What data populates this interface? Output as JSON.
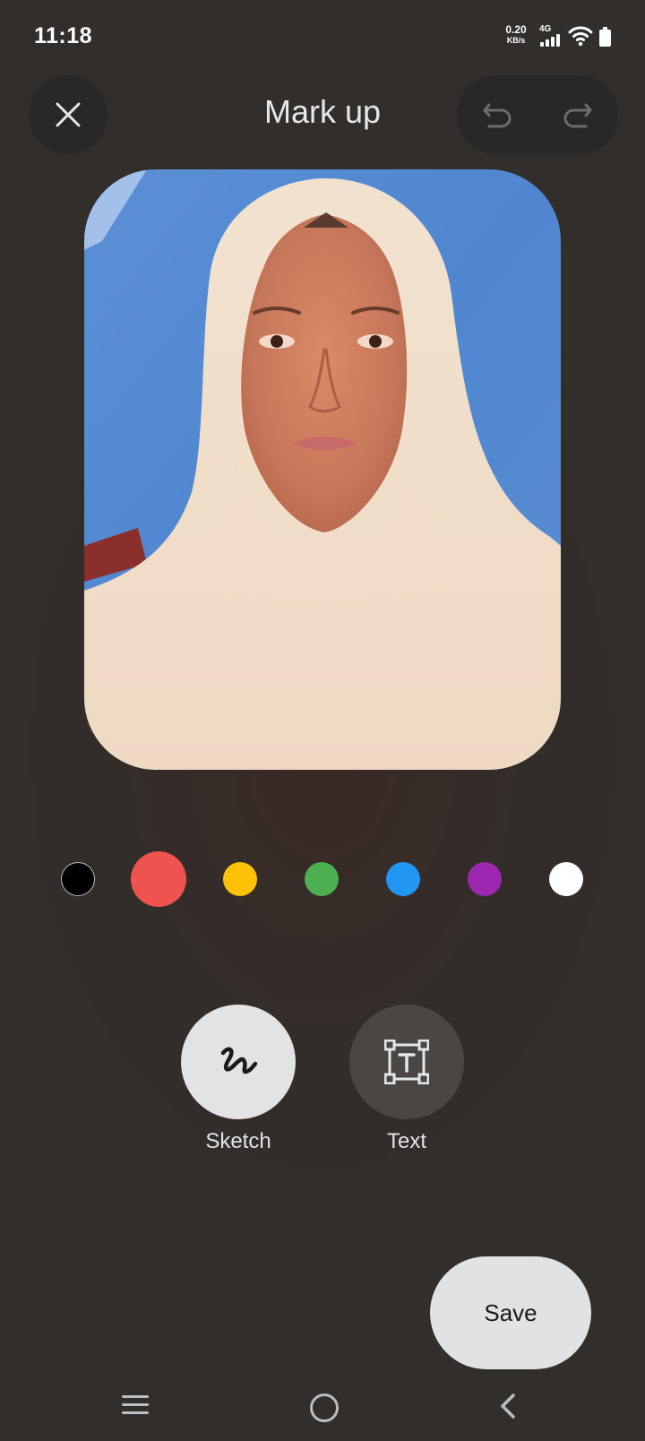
{
  "status_bar": {
    "time": "11:18",
    "net_speed_value": "0.20",
    "net_speed_unit": "KB/s",
    "network_type": "4G",
    "icons": [
      "signal-icon",
      "wifi-icon",
      "battery-icon"
    ]
  },
  "header": {
    "title": "Mark up",
    "close_icon": "close-icon",
    "undo_icon": "undo-icon",
    "redo_icon": "redo-icon"
  },
  "photo": {
    "description_icon": "photo-image"
  },
  "palette": {
    "colors": [
      {
        "name": "black",
        "hex": "#000000"
      },
      {
        "name": "red",
        "hex": "#EF5350",
        "selected": true
      },
      {
        "name": "yellow",
        "hex": "#FFC107"
      },
      {
        "name": "green",
        "hex": "#4CAF50"
      },
      {
        "name": "blue",
        "hex": "#2196F3"
      },
      {
        "name": "purple",
        "hex": "#9C27B0"
      },
      {
        "name": "white",
        "hex": "#FFFFFF"
      }
    ]
  },
  "tools": {
    "sketch_label": "Sketch",
    "text_label": "Text",
    "selected": "Sketch"
  },
  "actions": {
    "save_label": "Save"
  },
  "nav_bar": {
    "icons": [
      "menu-icon",
      "home-icon",
      "back-icon"
    ]
  }
}
